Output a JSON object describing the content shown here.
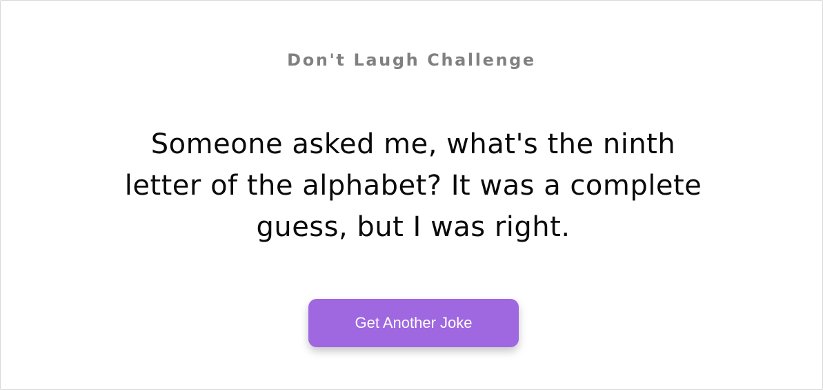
{
  "header": {
    "title": "Don't Laugh Challenge"
  },
  "joke": {
    "text": "Someone asked me, what's the ninth letter of the alphabet? It was a complete guess, but I was right."
  },
  "actions": {
    "next_joke_label": "Get Another Joke"
  },
  "colors": {
    "accent": "#9f68e0",
    "title_text": "#808080",
    "joke_text": "#0a0a0a",
    "background": "#ffffff"
  }
}
